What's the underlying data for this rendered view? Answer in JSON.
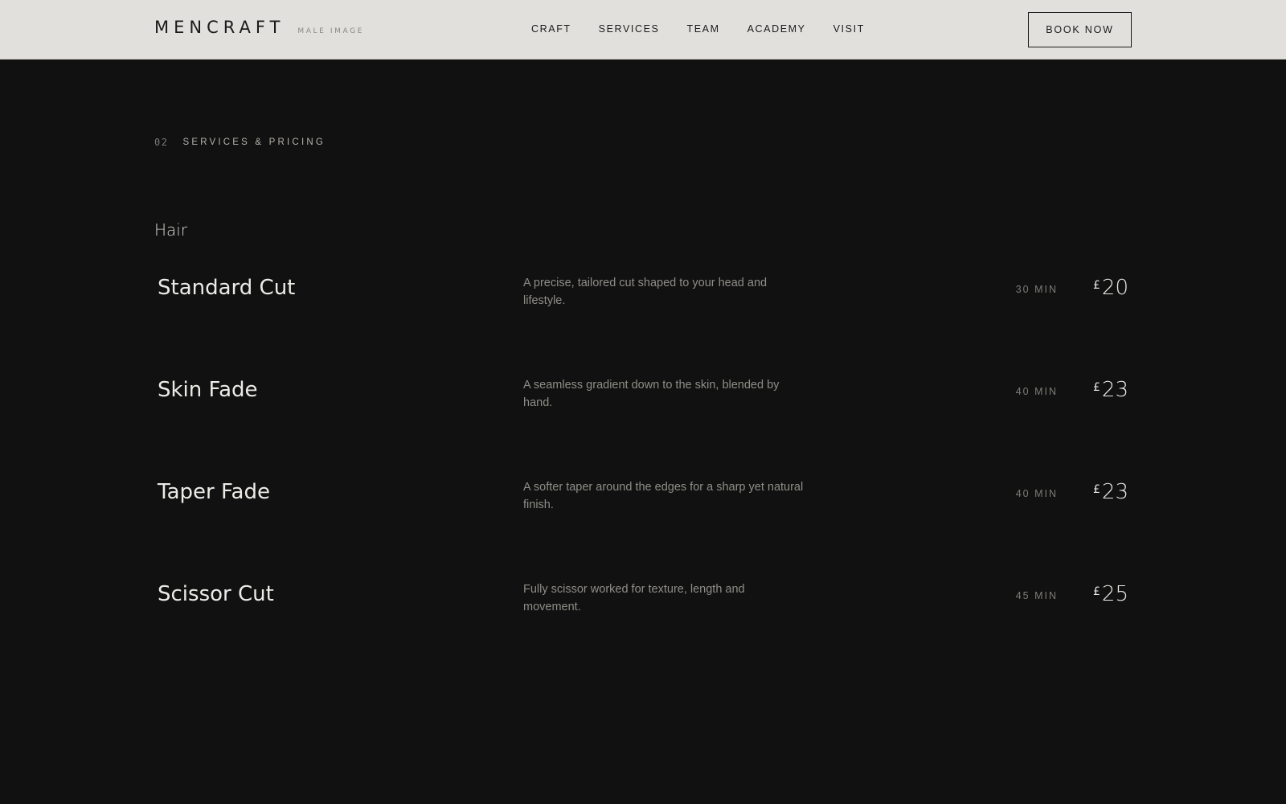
{
  "header": {
    "brand": "MENCRAFT",
    "brand_sub": "MALE IMAGE",
    "nav": [
      "CRAFT",
      "SERVICES",
      "TEAM",
      "ACADEMY",
      "VISIT"
    ],
    "cta": "BOOK NOW"
  },
  "section": {
    "number": "02",
    "title": "SERVICES & PRICING"
  },
  "category": "Hair",
  "services": [
    {
      "name": "Standard Cut",
      "description": "A precise, tailored cut shaped to your head and lifestyle.",
      "duration": "30 MIN",
      "currency": "£",
      "price": "20"
    },
    {
      "name": "Skin Fade",
      "description": "A seamless gradient down to the skin, blended by hand.",
      "duration": "40 MIN",
      "currency": "£",
      "price": "23"
    },
    {
      "name": "Taper Fade",
      "description": "A softer taper around the edges for a sharp yet natural finish.",
      "duration": "40 MIN",
      "currency": "£",
      "price": "23"
    },
    {
      "name": "Scissor Cut",
      "description": "Fully scissor worked for texture, length and movement.",
      "duration": "45 MIN",
      "currency": "£",
      "price": "25"
    }
  ],
  "colors": {
    "header_bg": "#e2e0dc",
    "page_bg": "#111111",
    "text_primary": "#ecebe7",
    "text_muted": "#8f8d88"
  }
}
